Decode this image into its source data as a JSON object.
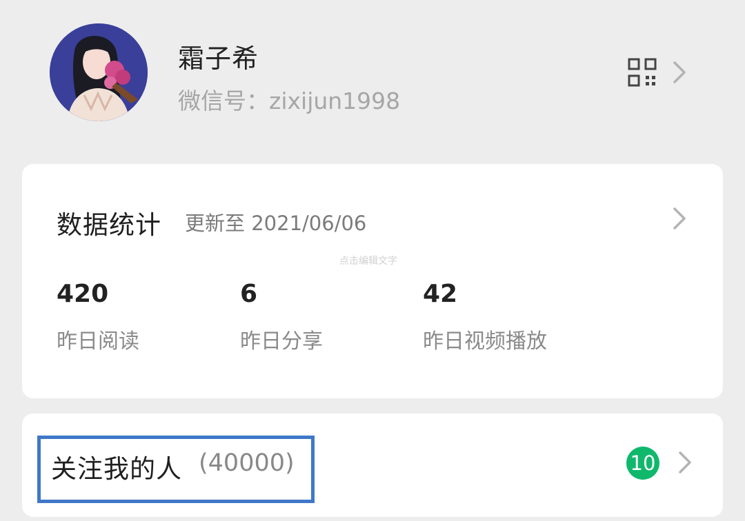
{
  "profile": {
    "name": "霜子希",
    "wechat_id": "微信号：zixijun1998",
    "avatar_icon": "portrait-avatar-icon",
    "qr_icon": "qr-code-icon"
  },
  "stats": {
    "title": "数据统计",
    "updated": "更新至 2021/06/06",
    "watermark": "点击编辑文字",
    "items": [
      {
        "value": "420",
        "label": "昨日阅读"
      },
      {
        "value": "6",
        "label": "昨日分享"
      },
      {
        "value": "42",
        "label": "昨日视频播放"
      }
    ]
  },
  "followers": {
    "title": "关注我的人",
    "count": "(40000)",
    "badge": "10"
  },
  "colors": {
    "background": "#ededed",
    "card": "#ffffff",
    "badge": "#10b86c",
    "highlight_border": "#3f78c8"
  }
}
